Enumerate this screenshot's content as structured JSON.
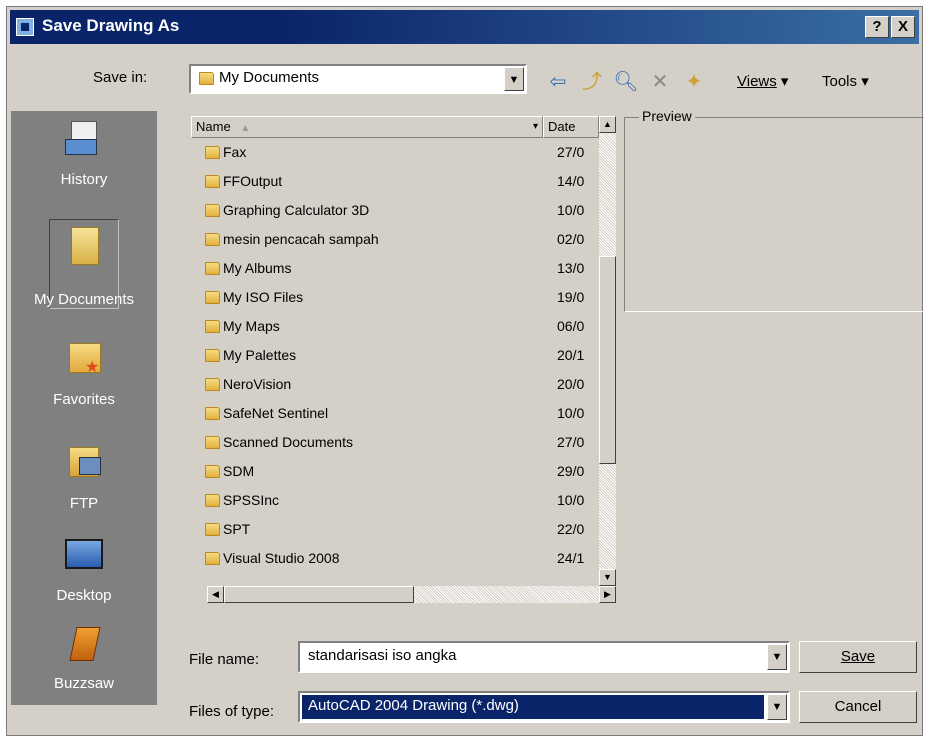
{
  "title": "Save Drawing As",
  "title_buttons": [
    "?",
    "X"
  ],
  "save_in": {
    "label": "Save in:",
    "value": "My Documents"
  },
  "toolbar": {
    "views": "Views",
    "tools": "Tools"
  },
  "places": [
    "History",
    "My Documents",
    "Favorites",
    "FTP",
    "Desktop",
    "Buzzsaw"
  ],
  "columns": {
    "name": "Name",
    "date": "Date"
  },
  "files": [
    {
      "name": "Fax",
      "date": "27/0"
    },
    {
      "name": "FFOutput",
      "date": "14/0"
    },
    {
      "name": "Graphing Calculator 3D",
      "date": "10/0"
    },
    {
      "name": "mesin pencacah sampah",
      "date": "02/0"
    },
    {
      "name": "My Albums",
      "date": "13/0"
    },
    {
      "name": "My ISO Files",
      "date": "19/0"
    },
    {
      "name": "My Maps",
      "date": "06/0"
    },
    {
      "name": "My Palettes",
      "date": "20/1"
    },
    {
      "name": "NeroVision",
      "date": "20/0"
    },
    {
      "name": "SafeNet Sentinel",
      "date": "10/0"
    },
    {
      "name": "Scanned Documents",
      "date": "27/0"
    },
    {
      "name": "SDM",
      "date": "29/0"
    },
    {
      "name": "SPSSInc",
      "date": "10/0"
    },
    {
      "name": "SPT",
      "date": "22/0"
    },
    {
      "name": "Visual Studio 2008",
      "date": "24/1"
    }
  ],
  "preview_label": "Preview",
  "file_name": {
    "label": "File name:",
    "value": "standarisasi iso angka"
  },
  "file_type": {
    "label": "Files of type:",
    "value": "AutoCAD 2004 Drawing (*.dwg)"
  },
  "buttons": {
    "save": "Save",
    "cancel": "Cancel"
  },
  "colors": {
    "title_bar": "#0a246a",
    "face": "#d4d0c8",
    "places_bar": "#808080",
    "selection": "#0a246a"
  }
}
